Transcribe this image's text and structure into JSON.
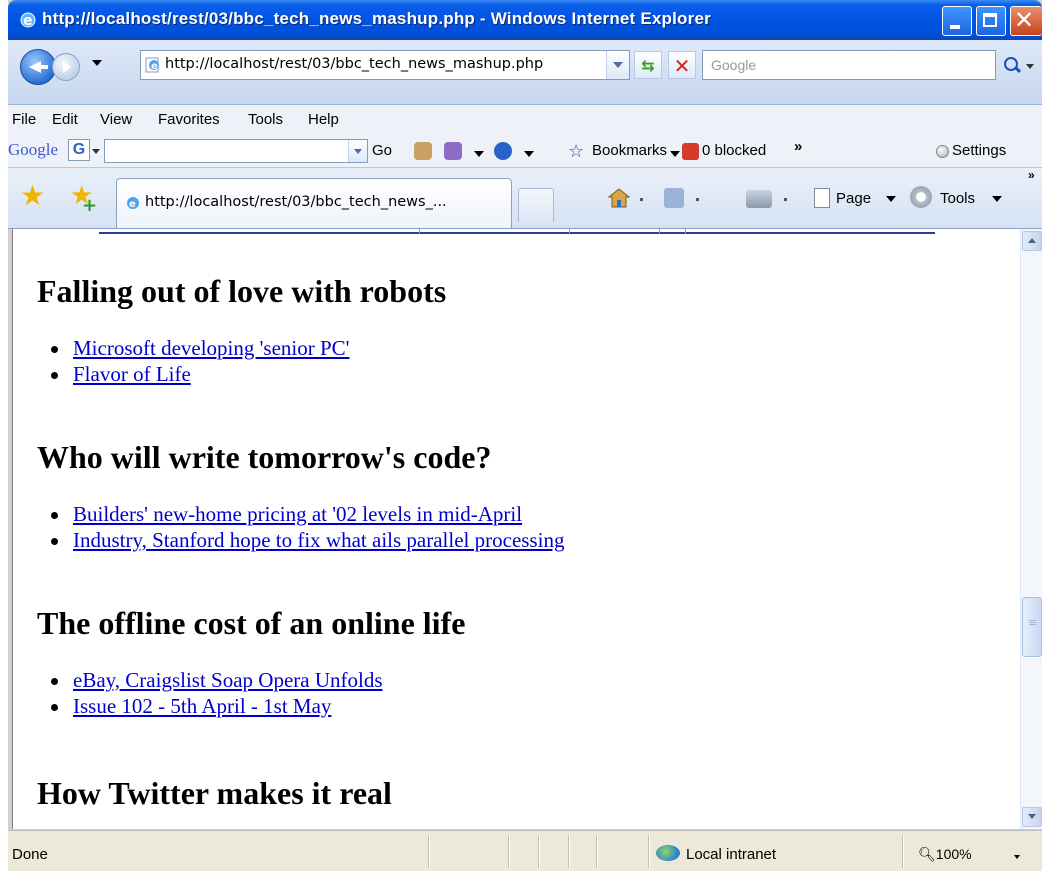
{
  "window": {
    "title": "http://localhost/rest/03/bbc_tech_news_mashup.php - Windows Internet Explorer"
  },
  "address_bar": {
    "url": "http://localhost/rest/03/bbc_tech_news_mashup.php",
    "search_placeholder": "Google"
  },
  "menu": {
    "items": [
      "File",
      "Edit",
      "View",
      "Favorites",
      "Tools",
      "Help"
    ]
  },
  "google_toolbar": {
    "logo": "Google",
    "g_button": "G",
    "go_label": "Go",
    "bookmarks_label": "Bookmarks",
    "blocked_label": "0 blocked",
    "more_label": "»",
    "settings_label": "Settings"
  },
  "tab": {
    "label": "http://localhost/rest/03/bbc_tech_news_..."
  },
  "command_bar": {
    "page_label": "Page",
    "tools_label": "Tools",
    "more_label": "»"
  },
  "articles": [
    {
      "title": "Falling out of love with robots",
      "links": [
        "Microsoft developing 'senior PC'",
        "Flavor of Life"
      ]
    },
    {
      "title": "Who will write tomorrow's code?",
      "links": [
        "Builders' new-home pricing at '02 levels in mid-April",
        "Industry, Stanford hope to fix what ails parallel processing"
      ]
    },
    {
      "title": "The offline cost of an online life",
      "links": [
        "eBay, Craigslist Soap Opera Unfolds",
        "Issue 102 - 5th April - 1st May"
      ]
    },
    {
      "title": "How Twitter makes it real",
      "links": []
    }
  ],
  "status_bar": {
    "status": "Done",
    "zone": "Local intranet",
    "zoom": "100%"
  },
  "colors": {
    "titlebar": "#0054e3",
    "link": "#0000cc"
  }
}
